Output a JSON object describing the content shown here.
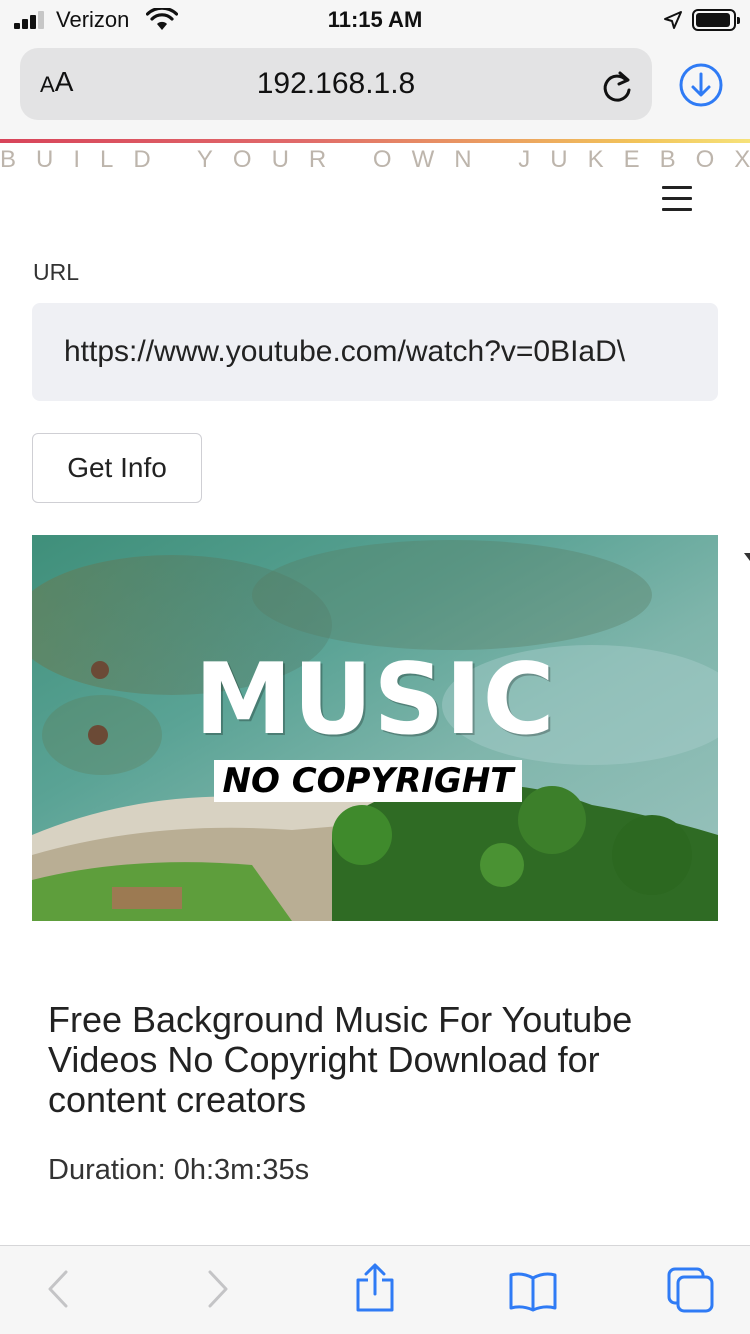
{
  "status_bar": {
    "carrier": "Verizon",
    "time": "11:15 AM",
    "icons": [
      "signal-icon",
      "wifi-icon",
      "location-arrow-icon",
      "battery-icon"
    ]
  },
  "browser": {
    "reader_button": {
      "small": "A",
      "big": "A"
    },
    "address": "192.168.1.8",
    "icons": [
      "reload-icon",
      "download-icon"
    ]
  },
  "site": {
    "title": "BUILD YOUR OWN JUKEBOX",
    "menu_icon": "hamburger-icon"
  },
  "form": {
    "url_label": "URL",
    "url_value": "https://www.youtube.com/watch?v=0BIaD\\",
    "get_info_label": "Get Info"
  },
  "video": {
    "thumbnail_title": "MUSIC",
    "thumbnail_subtitle": "NO COPYRIGHT",
    "title": "Free Background Music For Youtube Videos No Copyright Download for content creators",
    "duration": "Duration: 0h:3m:35s"
  },
  "toolbar": {
    "icons": [
      "back-icon",
      "forward-icon",
      "share-icon",
      "bookmarks-icon",
      "tabs-icon"
    ]
  },
  "colors": {
    "accent_gradient_start": "#d8445a",
    "accent_gradient_end": "#f6e27a",
    "safari_blue": "#2f7bf5",
    "site_title": "#bdb5ac",
    "input_bg": "#eff0f4"
  }
}
